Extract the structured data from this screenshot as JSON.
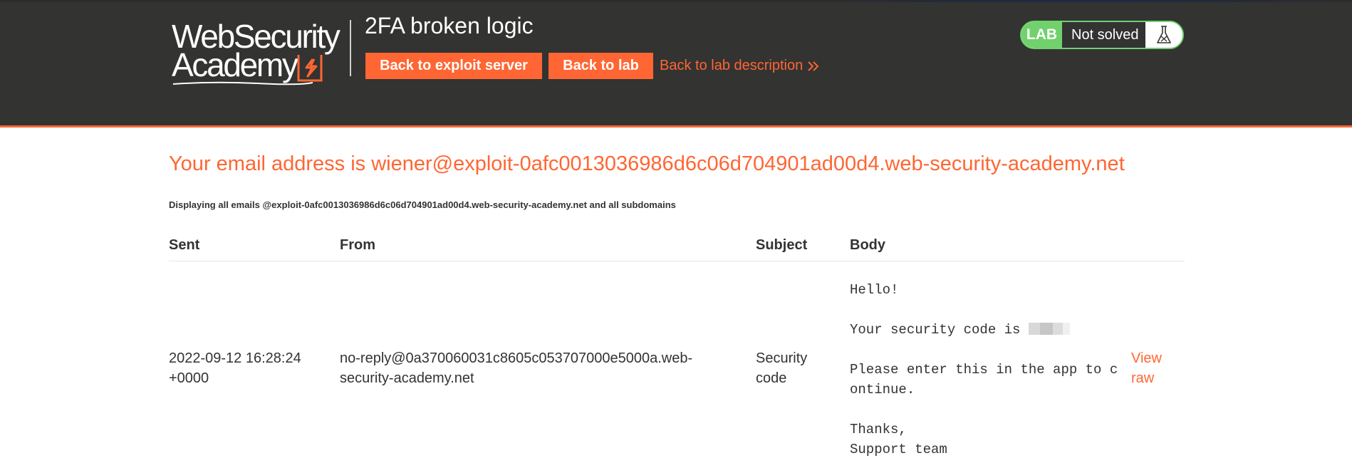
{
  "header": {
    "logo_line1": "WebSecurity",
    "logo_line2": "Academy",
    "lab_title": "2FA broken logic",
    "back_to_exploit_label": "Back to exploit server",
    "back_to_lab_label": "Back to lab",
    "back_to_desc_label": "Back to lab description",
    "status_badge": "LAB",
    "status_text": "Not solved",
    "icons": [
      "academy-logo-icon",
      "double-chevron-right-icon",
      "flask-icon"
    ],
    "colors": {
      "accent": "#ff6633",
      "header_bg": "#333332",
      "solved_green": "#70d16d"
    }
  },
  "main": {
    "email_heading": "Your email address is wiener@exploit-0afc0013036986d6c06d704901ad00d4.web-security-academy.net",
    "display_note": "Displaying all emails @exploit-0afc0013036986d6c06d704901ad00d4.web-security-academy.net and all subdomains",
    "table": {
      "columns": [
        "Sent",
        "From",
        "Subject",
        "Body"
      ],
      "rows": [
        {
          "sent": "2022-09-12 16:28:24 +0000",
          "from": "no-reply@0a370060031c8605c053707000e5000a.web-security-academy.net",
          "subject": "Security code",
          "body_greeting": "Hello!",
          "body_code_prefix": "Your security code is ",
          "body_instruction": "Please enter this in the app to continue.",
          "body_signoff": "Thanks,\nSupport team",
          "view_raw_label": "View raw"
        }
      ]
    }
  }
}
